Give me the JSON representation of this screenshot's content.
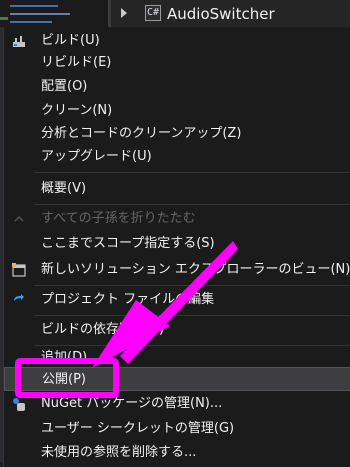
{
  "background": {
    "project_title": "AudioSwitcher",
    "project_icon_text": "C#"
  },
  "menu": {
    "items": [
      {
        "label": "ビルド(U)",
        "icon": "build-icon"
      },
      {
        "label": "リビルド(E)"
      },
      {
        "label": "配置(O)"
      },
      {
        "label": "クリーン(N)"
      },
      {
        "label": "分析とコードのクリーンアップ(Z)"
      },
      {
        "label": "アップグレード(U)"
      },
      {
        "label": "概要(V)"
      },
      {
        "label": "すべての子孫を折りたたむ",
        "disabled": true,
        "icon": "collapse-icon"
      },
      {
        "label": "ここまでスコープ指定する(S)"
      },
      {
        "label": "新しいソリューション エクスプローラーのビュー(N)",
        "icon": "new-view-icon"
      },
      {
        "label": "プロジェクト ファイルの編集",
        "icon": "edit-project-icon"
      },
      {
        "label": "ビルドの依存関係(B)"
      },
      {
        "label": "追加(D)"
      },
      {
        "label": "公開(P)",
        "highlighted": true
      },
      {
        "label": "NuGet パッケージの管理(N)...",
        "icon": "nuget-icon"
      },
      {
        "label": "ユーザー シークレットの管理(G)"
      },
      {
        "label": "未使用の参照を削除する..."
      }
    ]
  },
  "annotation": {
    "color": "#ff00ff"
  }
}
